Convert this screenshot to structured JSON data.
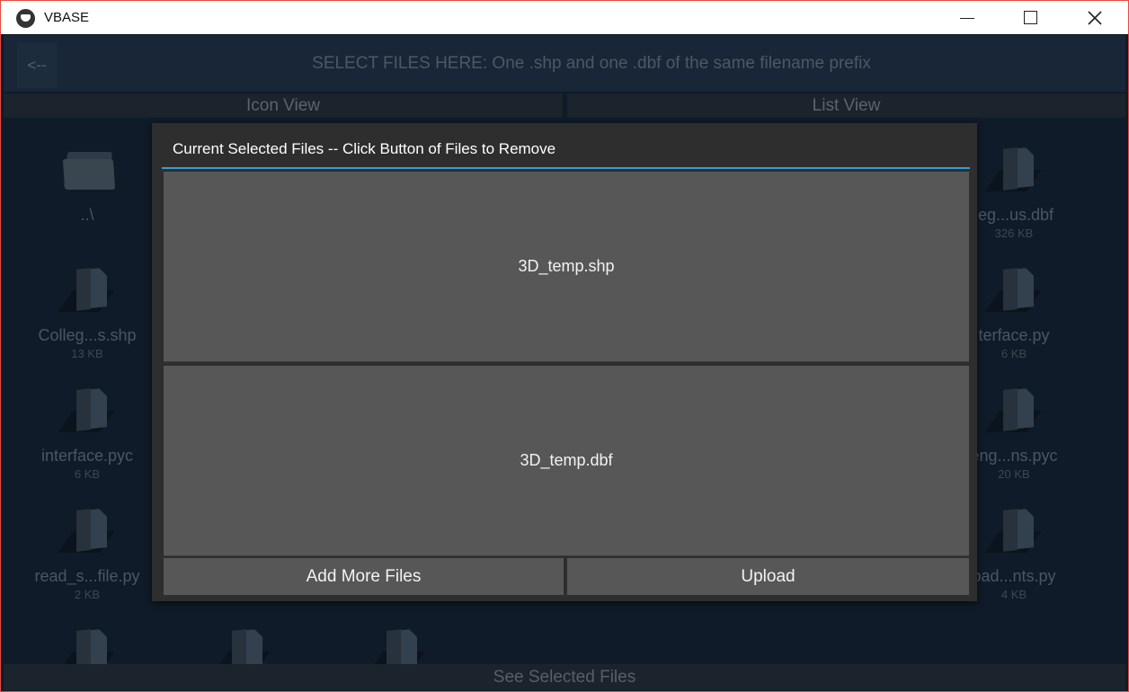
{
  "window": {
    "title": "VBASE"
  },
  "header": {
    "back_label": "<--",
    "instruction": "SELECT FILES HERE: One .shp and one .dbf of the same filename prefix"
  },
  "tabs": {
    "icon_view": "Icon View",
    "list_view": "List View"
  },
  "files": [
    {
      "name": "..\\",
      "size": "",
      "kind": "folder-icon"
    },
    {
      "name": "leg...us.dbf",
      "size": "326 KB",
      "kind": "file-icon"
    },
    {
      "name": "Colleg...s.shp",
      "size": "13 KB",
      "kind": "file-icon"
    },
    {
      "name": "terface.py",
      "size": "6 KB",
      "kind": "file-icon"
    },
    {
      "name": "interface.pyc",
      "size": "6 KB",
      "kind": "file-icon"
    },
    {
      "name": "eng...ns.pyc",
      "size": "20 KB",
      "kind": "file-icon"
    },
    {
      "name": "read_s...file.py",
      "size": "2 KB",
      "kind": "file-icon"
    },
    {
      "name": "oad...nts.py",
      "size": "4 KB",
      "kind": "file-icon"
    }
  ],
  "bottom_bar": {
    "label": "See Selected Files"
  },
  "modal": {
    "title": "Current Selected Files -- Click Button of Files to Remove",
    "selected_files": [
      "3D_temp.shp",
      "3D_temp.dbf"
    ],
    "add_more_label": "Add More Files",
    "upload_label": "Upload"
  },
  "colors": {
    "accent": "#33a0d6",
    "window_border": "#e8493f",
    "background": "#0f1b28",
    "modal_bg": "#2e2e2e",
    "button_bg": "#575757"
  }
}
